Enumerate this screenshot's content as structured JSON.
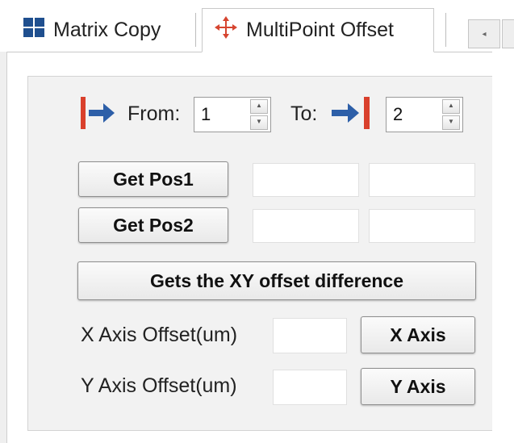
{
  "tabs": [
    {
      "label": "Matrix Copy",
      "icon": "matrix-grid-icon",
      "active": false
    },
    {
      "label": "MultiPoint Offset",
      "icon": "four-way-arrows-icon",
      "active": true
    }
  ],
  "panel": {
    "from_label": "From:",
    "from_value": "1",
    "to_label": "To:",
    "to_value": "2",
    "get_pos1_label": "Get Pos1",
    "get_pos2_label": "Get Pos2",
    "get_offset_label": "Gets the XY offset difference",
    "x_offset_label": "X Axis Offset(um)",
    "y_offset_label": "Y Axis Offset(um)",
    "x_axis_button": "X Axis",
    "y_axis_button": "Y Axis",
    "pos1_x": "",
    "pos1_y": "",
    "pos2_x": "",
    "pos2_y": "",
    "x_offset_value": "",
    "y_offset_value": ""
  },
  "colors": {
    "arrow_blue": "#2d5fa8",
    "bar_red": "#d9402c",
    "matrix_blue": "#1f4f8f"
  }
}
